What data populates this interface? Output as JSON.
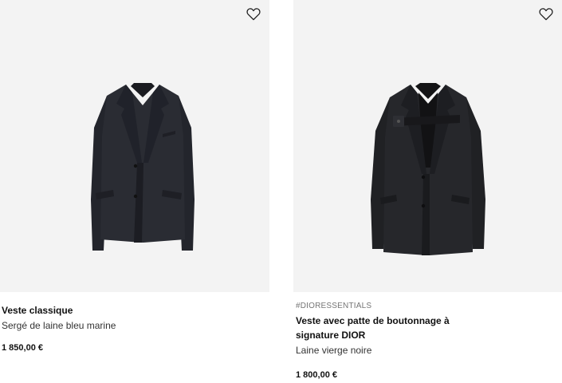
{
  "products": [
    {
      "tag": "",
      "title": "Veste classique",
      "subtitle": "Sergé de laine bleu marine",
      "price": "1 850,00 €",
      "favorite_icon": "heart-outline-icon",
      "image": "navy-blazer-photo"
    },
    {
      "tag": "#DIORESSENTIALS",
      "title": "Veste avec patte de boutonnage à signature DIOR",
      "subtitle": "Laine vierge noire",
      "price": "1 800,00 €",
      "favorite_icon": "heart-outline-icon",
      "image": "black-blazer-strap-photo"
    }
  ],
  "colors": {
    "image_background": "#f3f3f3",
    "text_primary": "#111111",
    "text_secondary": "#757575"
  }
}
